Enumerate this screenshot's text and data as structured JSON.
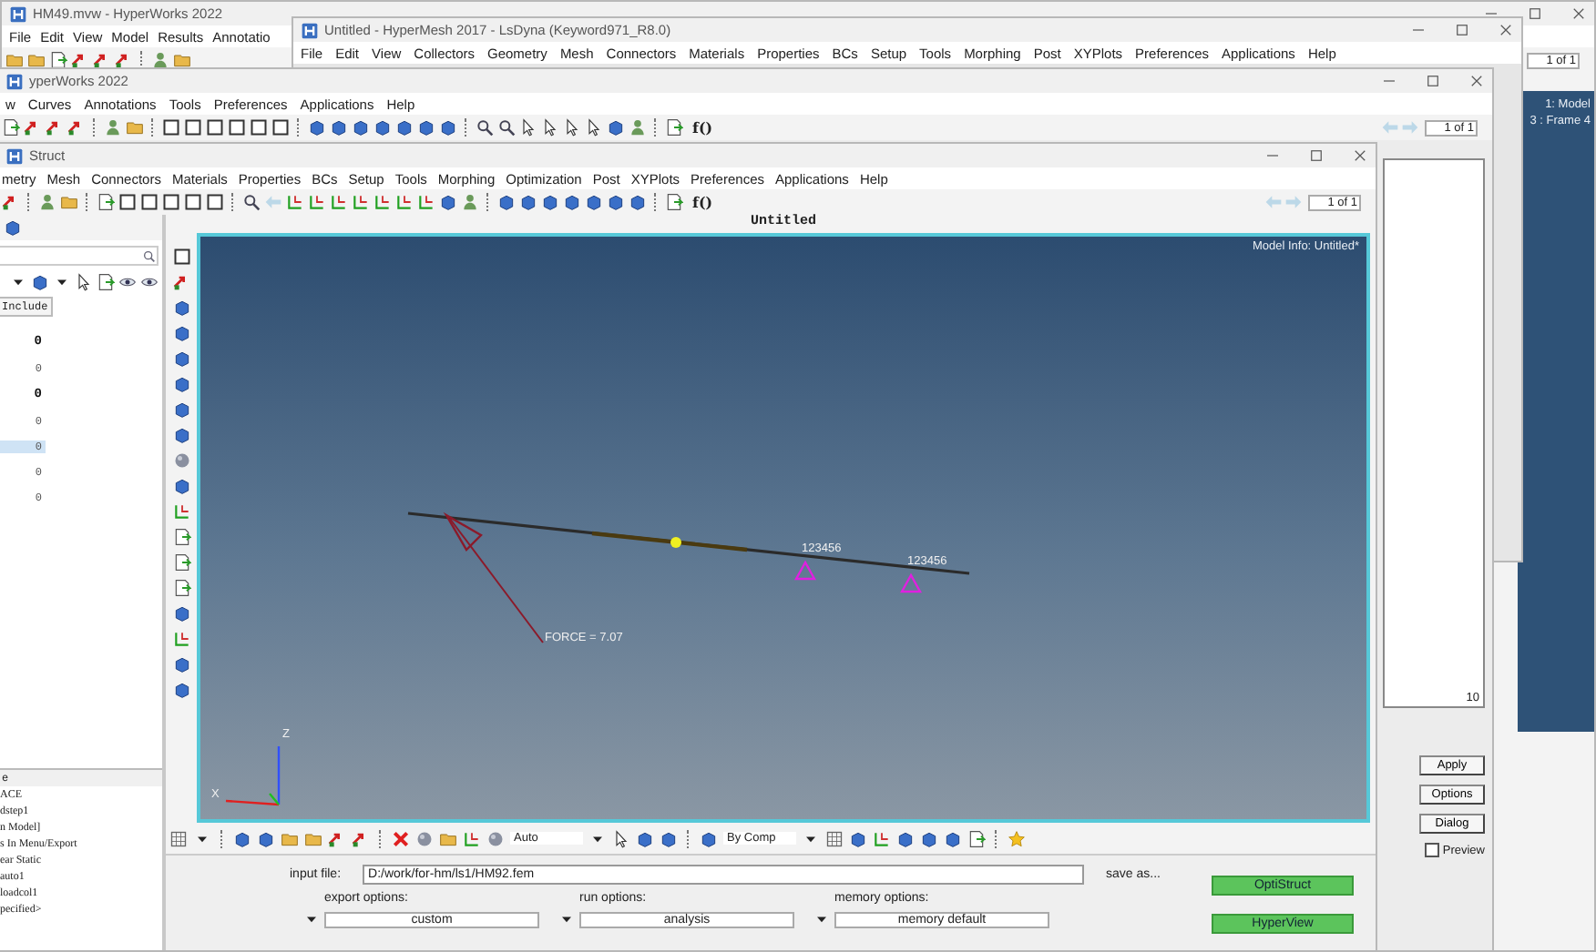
{
  "hyperworks_back": {
    "title": "HM49.mvw - HyperWorks 2022",
    "menu": [
      "File",
      "Edit",
      "View",
      "Model",
      "Results",
      "Annotatio"
    ],
    "page": "1 of 1",
    "frames": [
      "1: Model",
      "3 : Frame 4"
    ]
  },
  "hypermesh_2017": {
    "title": "Untitled - HyperMesh 2017 - LsDyna (Keyword971_R8.0)",
    "menu": [
      "File",
      "Edit",
      "View",
      "Collectors",
      "Geometry",
      "Mesh",
      "Connectors",
      "Materials",
      "Properties",
      "BCs",
      "Setup",
      "Tools",
      "Morphing",
      "Post",
      "XYPlots",
      "Preferences",
      "Applications",
      "Help"
    ]
  },
  "hyperworks_middle": {
    "title": "yperWorks 2022",
    "menu": [
      "w",
      "Curves",
      "Annotations",
      "Tools",
      "Preferences",
      "Applications",
      "Help"
    ],
    "formula": "f()",
    "page": "1 of 1",
    "axis_label": "10",
    "side_buttons": [
      "Apply",
      "Options",
      "Dialog"
    ],
    "preview": {
      "label": "Preview",
      "checked": false
    }
  },
  "optistruct": {
    "title": "Struct",
    "menu": [
      "metry",
      "Mesh",
      "Connectors",
      "Materials",
      "Properties",
      "BCs",
      "Setup",
      "Tools",
      "Morphing",
      "Optimization",
      "Post",
      "XYPlots",
      "Preferences",
      "Applications",
      "Help"
    ],
    "formula": "f()",
    "page": "1 of 1",
    "browser": {
      "column": "Include",
      "rows": [
        {
          "value": "0",
          "bold": true,
          "selected": false
        },
        {
          "value": "0",
          "bold": false,
          "selected": false
        },
        {
          "value": "0",
          "bold": true,
          "selected": false
        },
        {
          "value": "0",
          "bold": false,
          "selected": false
        },
        {
          "value": "0",
          "bold": false,
          "selected": true
        },
        {
          "value": "0",
          "bold": false,
          "selected": false
        },
        {
          "value": "0",
          "bold": false,
          "selected": false
        }
      ],
      "list_header": "e",
      "list": [
        "ACE",
        "dstep1",
        "n Model]",
        "s In Menu/Export",
        "ear Static",
        "auto1",
        "loadcol1",
        "pecified>"
      ]
    },
    "viewport": {
      "title": "Untitled",
      "model_info": "Model Info: Untitled*",
      "constraint_labels": [
        "123456",
        "123456"
      ],
      "force_label": "FORCE = 7.07",
      "axis_labels": [
        "Z",
        "X"
      ]
    },
    "toolbar_dropdowns": [
      "Auto",
      "By Comp"
    ],
    "panel": {
      "input_label": "input file:",
      "input_value": "D:/work/for-hm/ls1/HM92.fem",
      "save_as": "save as...",
      "buttons": [
        "OptiStruct",
        "HyperView"
      ],
      "options": [
        {
          "label": "export options:",
          "value": "custom"
        },
        {
          "label": "run options:",
          "value": "analysis"
        },
        {
          "label": "memory options:",
          "value": "memory default"
        }
      ]
    }
  }
}
